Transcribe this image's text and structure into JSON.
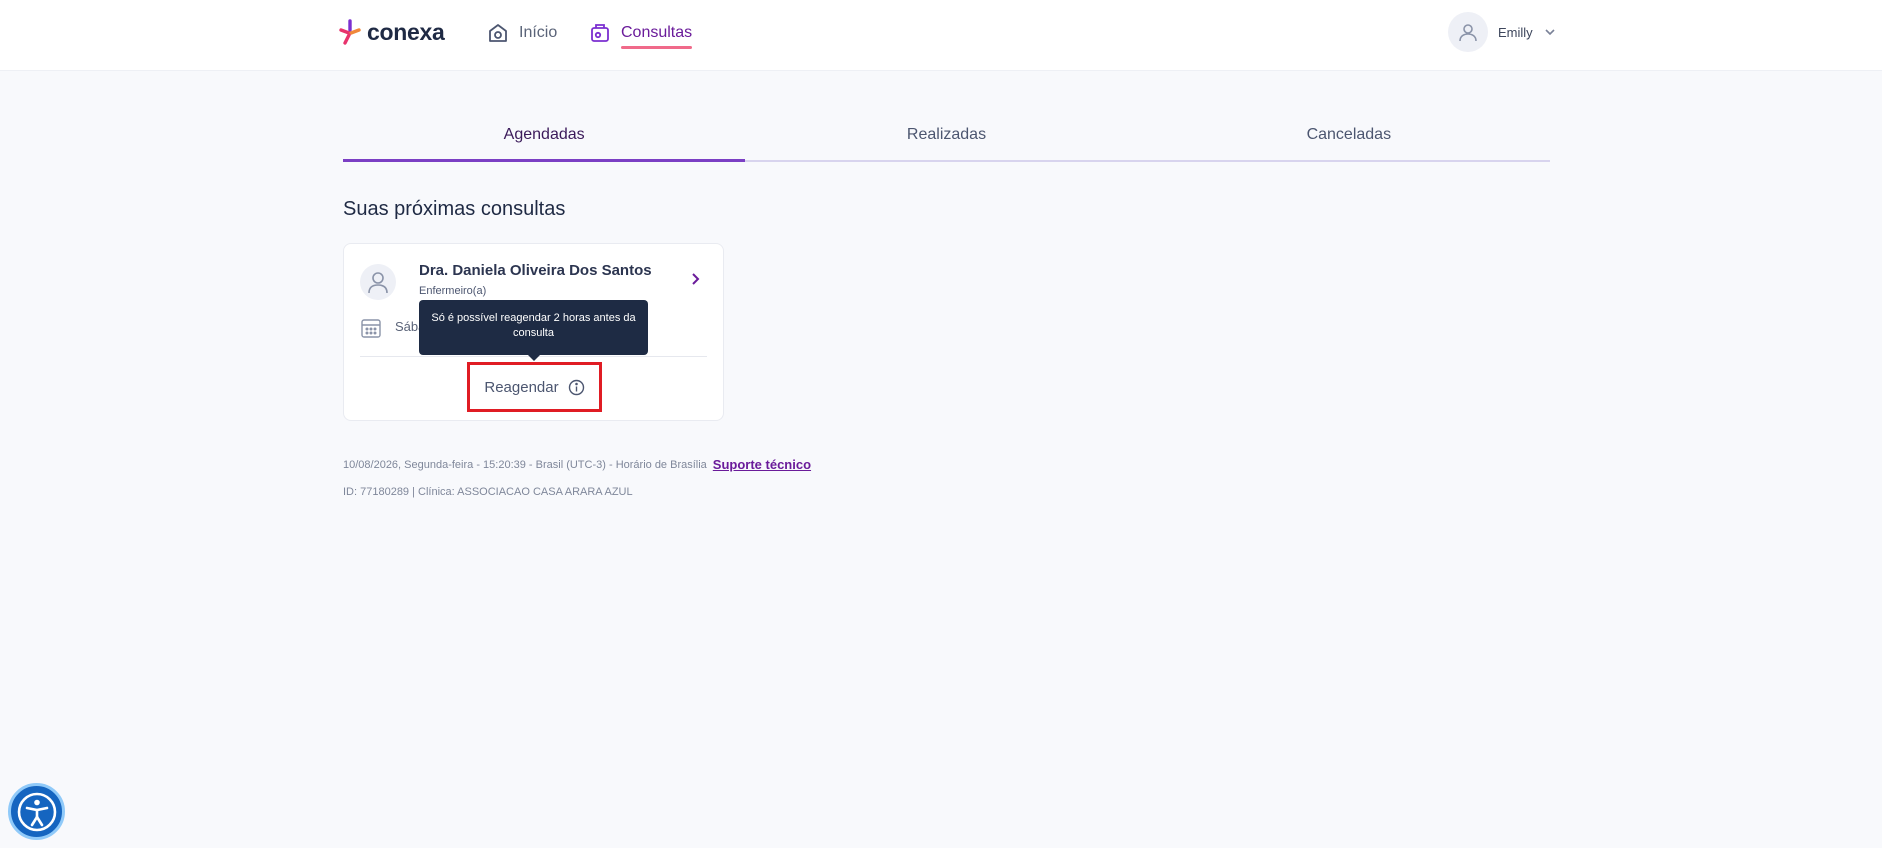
{
  "header": {
    "logo_text": "conexa",
    "nav": {
      "inicio_label": "Início",
      "consultas_label": "Consultas"
    },
    "user_name": "Emilly"
  },
  "tabs": [
    {
      "label": "Agendadas",
      "active": true
    },
    {
      "label": "Realizadas",
      "active": false
    },
    {
      "label": "Canceladas",
      "active": false
    }
  ],
  "section_title": "Suas próximas consultas",
  "appointment": {
    "doctor_name": "Dra. Daniela Oliveira Dos Santos",
    "role": "Enfermeiro(a)",
    "date_partial": "Sába",
    "reschedule_label": "Reagendar",
    "tooltip": "Só é possível reagendar 2 horas antes da consulta"
  },
  "footer": {
    "datetime": "10/08/2026, Segunda-feira - 15:20:39 - Brasil (UTC-3) - Horário de Brasília",
    "support_label": "Suporte técnico",
    "id_line": "ID: 77180289 | Clínica: ASSOCIACAO CASA ARARA AZUL"
  },
  "colors": {
    "accent": "#6a1b9a",
    "underline": "#f06a8a",
    "tooltip_bg": "#1e2b44",
    "highlight": "#e01c24"
  }
}
